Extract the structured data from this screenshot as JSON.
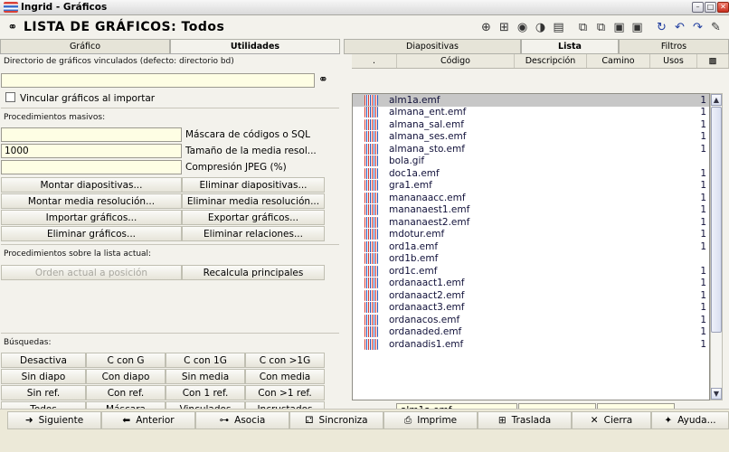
{
  "window": {
    "title": "Ingrid - Gráficos"
  },
  "header": {
    "title": "LISTA DE GRÁFICOS: Todos"
  },
  "left": {
    "tabs": [
      "Gráfico",
      "Utilidades"
    ],
    "dir_label": "Directorio de gráficos vinculados (defecto: directorio bd)",
    "dir_value": "",
    "link_check": "Vincular gráficos al importar",
    "mass_label": "Procedimientos masivos:",
    "mask_label": "Máscara de códigos o SQL",
    "mask_value": "",
    "half_label": "Tamaño de la media resol...",
    "half_value": "1000",
    "jpeg_label": "Compresión JPEG (%)",
    "jpeg_value": "",
    "mass_buttons": [
      "Montar diapositivas...",
      "Eliminar diapositivas...",
      "Montar media resolución...",
      "Eliminar media resolución...",
      "Importar gráficos...",
      "Exportar gráficos...",
      "Eliminar gráficos...",
      "Eliminar relaciones..."
    ],
    "list_label": "Procedimientos sobre la lista actual:",
    "list_buttons": [
      "Orden actual a posición",
      "Recalcula principales"
    ],
    "search_label": "Búsquedas:",
    "search_buttons": [
      "Desactiva",
      "C con G",
      "C con 1G",
      "C con >1G",
      "Sin diapo",
      "Con diapo",
      "Sin media",
      "Con media",
      "Sin ref.",
      "Con ref.",
      "Con 1 ref.",
      "Con >1 ref.",
      "Todos",
      "Máscara",
      "Vinculados",
      "Incrustados"
    ]
  },
  "right": {
    "tabs": [
      "Diapositivas",
      "Lista",
      "Filtros"
    ],
    "columns": [
      ".",
      "Código",
      "Descripción",
      "Camino",
      "Usos",
      "▩"
    ],
    "rows": [
      {
        "code": "alm1a.emf",
        "uses": "1"
      },
      {
        "code": "almana_ent.emf",
        "uses": "1"
      },
      {
        "code": "almana_sal.emf",
        "uses": "1"
      },
      {
        "code": "almana_ses.emf",
        "uses": "1"
      },
      {
        "code": "almana_sto.emf",
        "uses": "1"
      },
      {
        "code": "bola.gif",
        "uses": ""
      },
      {
        "code": "doc1a.emf",
        "uses": "1"
      },
      {
        "code": "gra1.emf",
        "uses": "1"
      },
      {
        "code": "mananaacc.emf",
        "uses": "1"
      },
      {
        "code": "mananaest1.emf",
        "uses": "1"
      },
      {
        "code": "mananaest2.emf",
        "uses": "1"
      },
      {
        "code": "mdotur.emf",
        "uses": "1"
      },
      {
        "code": "ord1a.emf",
        "uses": "1"
      },
      {
        "code": "ord1b.emf",
        "uses": ""
      },
      {
        "code": "ord1c.emf",
        "uses": "1"
      },
      {
        "code": "ordanaact1.emf",
        "uses": "1"
      },
      {
        "code": "ordanaact2.emf",
        "uses": "1"
      },
      {
        "code": "ordanaact3.emf",
        "uses": "1"
      },
      {
        "code": "ordanacos.emf",
        "uses": "1"
      },
      {
        "code": "ordanaded.emf",
        "uses": "1"
      },
      {
        "code": "ordanadis1.emf",
        "uses": "1"
      }
    ],
    "selected_code": "alm1a.emf"
  },
  "bottom": {
    "buttons": [
      "Siguiente",
      "Anterior",
      "Asocia",
      "Sincroniza",
      "Imprime",
      "Traslada",
      "Cierra",
      "Ayuda..."
    ]
  }
}
